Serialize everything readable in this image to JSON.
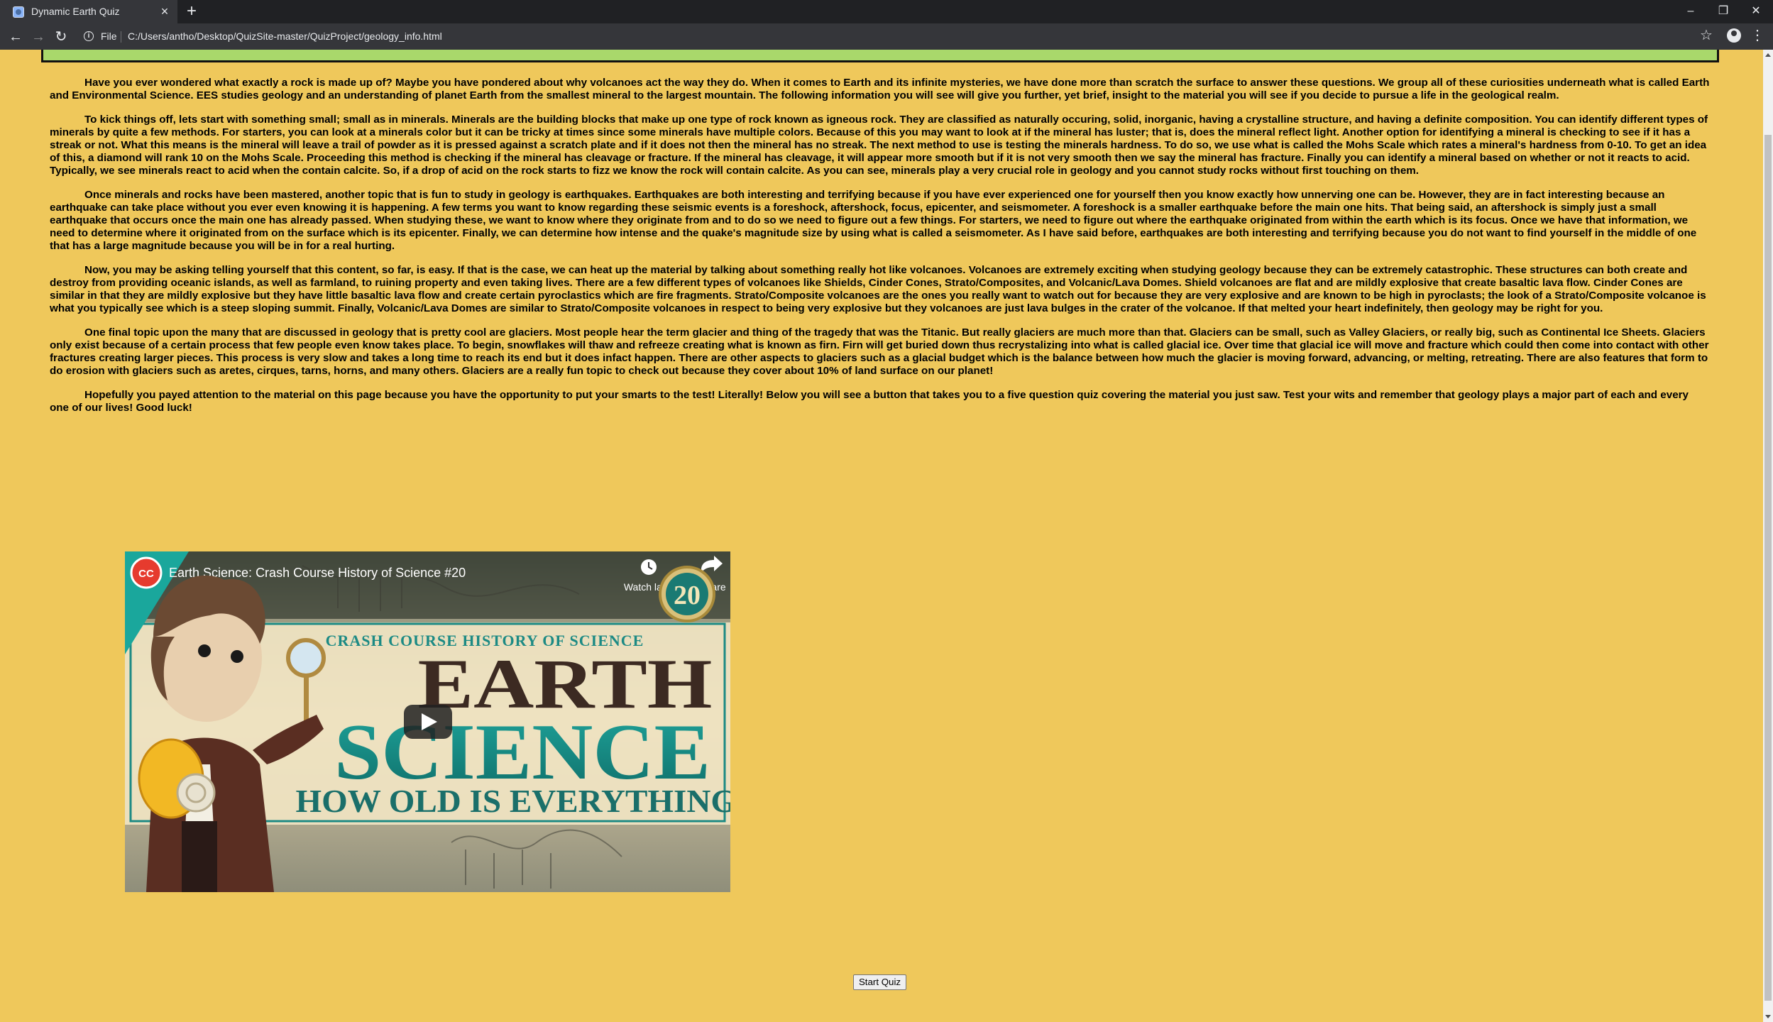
{
  "browser": {
    "tab_title": "Dynamic Earth Quiz",
    "scheme_label": "File",
    "url": "C:/Users/antho/Desktop/QuizSite-master/QuizProject/geology_info.html"
  },
  "article": {
    "paragraphs": [
      "Have you ever wondered what exactly a rock is made up of? Maybe you have pondered about why volcanoes act the way they do. When it comes to Earth and its infinite mysteries, we have done more than scratch the surface to answer these questions. We group all of these curiosities underneath what is called Earth and Environmental Science. EES studies geology and an understanding of planet Earth from the smallest mineral to the largest mountain. The following information you will see will give you further, yet brief, insight to the material you will see if you decide to pursue a life in the geological realm.",
      "To kick things off, lets start with something small; small as in minerals. Minerals are the building blocks that make up one type of rock known as igneous rock. They are classified as naturally occuring, solid, inorganic, having a crystalline structure, and having a definite composition. You can identify different types of minerals by quite a few methods. For starters, you can look at a minerals color but it can be tricky at times since some minerals have multiple colors. Because of this you may want to look at if the mineral has luster; that is, does the mineral reflect light. Another option for identifying a mineral is checking to see if it has a streak or not. What this means is the mineral will leave a trail of powder as it is pressed against a scratch plate and if it does not then the mineral has no streak. The next method to use is testing the minerals hardness. To do so, we use what is called the Mohs Scale which rates a mineral's hardness from 0-10. To get an idea of this, a diamond will rank 10 on the Mohs Scale. Proceeding this method is checking if the mineral has cleavage or fracture. If the mineral has cleavage, it will appear more smooth but if it is not very smooth then we say the mineral has fracture. Finally you can identify a mineral based on whether or not it reacts to acid. Typically, we see minerals react to acid when the contain calcite. So, if a drop of acid on the rock starts to fizz we know the rock will contain calcite. As you can see, minerals play a very crucial role in geology and you cannot study rocks without first touching on them.",
      "Once minerals and rocks have been mastered, another topic that is fun to study in geology is earthquakes. Earthquakes are both interesting and terrifying because if you have ever experienced one for yourself then you know exactly how unnerving one can be. However, they are in fact interesting because an earthquake can take place without you ever even knowing it is happening. A few terms you want to know regarding these seismic events is a foreshock, aftershock, focus, epicenter, and seismometer. A foreshock is a smaller earthquake before the main one hits. That being said, an aftershock is simply just a small earthquake that occurs once the main one has already passed. When studying these, we want to know where they originate from and to do so we need to figure out a few things. For starters, we need to figure out where the earthquake originated from within the earth which is its focus. Once we have that information, we need to determine where it originated from on the surface which is its epicenter. Finally, we can determine how intense and the quake's magnitude size by using what is called a seismometer. As I have said before, earthquakes are both interesting and terrifying because you do not want to find yourself in the middle of one that has a large magnitude because you will be in for a real hurting.",
      "Now, you may be asking telling yourself that this content, so far, is easy. If that is the case, we can heat up the material by talking about something really hot like volcanoes. Volcanoes are extremely exciting when studying geology because they can be extremely catastrophic. These structures can both create and destroy from providing oceanic islands, as well as farmland, to ruining property and even taking lives. There are a few different types of volcanoes like Shields, Cinder Cones, Strato/Composites, and Volcanic/Lava Domes. Shield volcanoes are flat and are mildly explosive that create basaltic lava flow. Cinder Cones are similar in that they are mildly explosive but they have little basaltic lava flow and create certain pyroclastics which are fire fragments. Strato/Composite volcanoes are the ones you really want to watch out for because they are very explosive and are known to be high in pyroclasts; the look of a Strato/Composite volcanoe is what you typically see which is a steep sloping summit. Finally, Volcanic/Lava Domes are similar to Strato/Composite volcanoes in respect to being very explosive but they volcanoes are just lava bulges in the crater of the volcanoe. If that melted your heart indefinitely, then geology may be right for you.",
      "One final topic upon the many that are discussed in geology that is pretty cool are glaciers. Most people hear the term glacier and thing of the tragedy that was the Titanic. But really glaciers are much more than that. Glaciers can be small, such as Valley Glaciers, or really big, such as Continental Ice Sheets. Glaciers only exist because of a certain process that few people even know takes place. To begin, snowflakes will thaw and refreeze creating what is known as firn. Firn will get buried down thus recrystalizing into what is called glacial ice. Over time that glacial ice will move and fracture which could then come into contact with other fractures creating larger pieces. This process is very slow and takes a long time to reach its end but it does infact happen. There are other aspects to glaciers such as a glacial budget which is the balance between how much the glacier is moving forward, advancing, or melting, retreating. There are also features that form to do erosion with glaciers such as aretes, cirques, tarns, horns, and many others. Glaciers are a really fun topic to check out because they cover about 10% of land surface on our planet!",
      "Hopefully you payed attention to the material on this page because you have the opportunity to put your smarts to the test! Literally! Below you will see a button that takes you to a five question quiz covering the material you just saw. Test your wits and remember that geology plays a major part of each and every one of our lives! Good luck!"
    ]
  },
  "video": {
    "title": "Earth Science: Crash Course History of Science #20",
    "watch_later_label": "Watch later",
    "share_label": "Share",
    "channel_logo_text": "CC",
    "episode_number": "20",
    "series_banner": "CRASH COURSE HISTORY OF SCIENCE",
    "headline_1": "EARTH",
    "headline_2": "SCIENCE",
    "subheadline": "HOW OLD IS EVERYTHING?"
  },
  "quiz": {
    "start_label": "Start Quiz"
  }
}
